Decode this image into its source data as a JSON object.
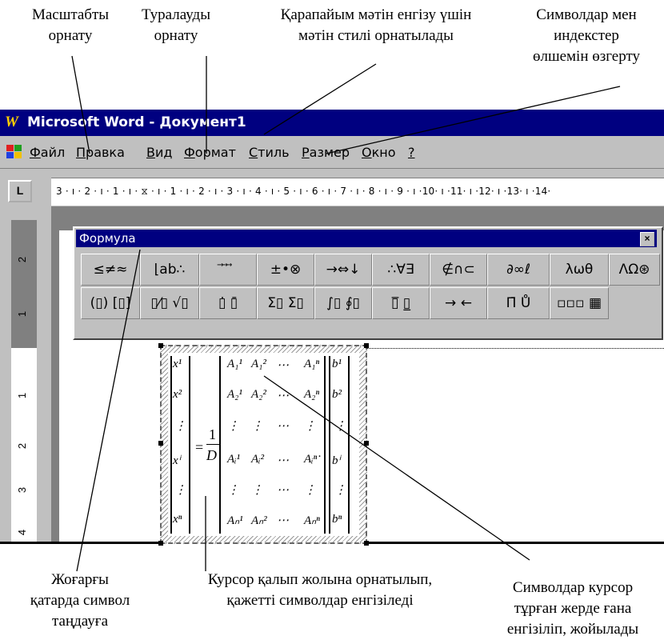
{
  "captions": {
    "top_scale": "Масштабты\nорнату",
    "top_align": "Туралауды\nорнату",
    "top_text": "Қарапайым мәтін енгізу үшін\nмәтін стилі орнатылады",
    "top_size": "Символдар мен\nиндекстер\nөлшемін өзгерту",
    "bottom_upper": "Жоғарғы\nқатарда символ\nтаңдауға",
    "bottom_cursor": "Курсор қалып жолына орнатылып,\nқажетті символдар енгізіледі",
    "bottom_symbols": "Символдар курсор\nтұрған жерде ғана\nенгізіліп, жойылады"
  },
  "window": {
    "icon": "W",
    "title": "Microsoft Word - Документ1"
  },
  "menu": {
    "items": [
      "Файл",
      "Правка",
      "Вид",
      "Формат",
      "Стиль",
      "Размер",
      "Окно",
      "?"
    ]
  },
  "ruler": {
    "tab_button": "L",
    "numbers": "3 · ı · 2 · ı · 1 · ı · ⧖ · ı · 1 · ı · 2 · ı · 3 · ı · 4 · ı · 5 · ı · 6 · ı · 7 · ı · 8 · ı · 9 · ı ·10· ı ·11· ı ·12· ı ·13· ı ·14·",
    "vertical": [
      "2",
      "1",
      "1",
      "2",
      "3",
      "4"
    ]
  },
  "palette": {
    "title": "Формула",
    "close": "×",
    "row1": [
      "≤≠≈",
      "⌊ab∴",
      "⃗ ⃗ ⃗",
      "±•⊗",
      "→⇔↓",
      "∴∀∃",
      "∉∩⊂",
      "∂∞ℓ",
      "λωθ",
      "ΛΩ⊛"
    ],
    "row2": [
      "(▯) [▯]",
      "▯⁄▯ √▯",
      "▯̇ ▯̄",
      "Σ▯ Σ▯",
      "∫▯ ∮▯",
      "▯̅ ▯̲",
      "→ ←",
      "Π̄ Ů",
      "▫▫▫ ▦"
    ]
  },
  "equation": {
    "x_col": [
      "x¹",
      "x²",
      "⋮",
      "xⁱ",
      "⋮",
      "xⁿ"
    ],
    "fraction_num": "1",
    "fraction_den": "D",
    "eq_sign": "=",
    "row_labels": [
      "A₁¹",
      "A₁²",
      "⋯",
      "A₁ⁿ"
    ],
    "rows": [
      [
        "A₁¹",
        "A₁²",
        "⋯",
        "A₁ⁿ"
      ],
      [
        "A₂¹",
        "A₂²",
        "⋯",
        "A₂ⁿ"
      ],
      [
        "⋮",
        "⋮",
        "⋯",
        "⋮"
      ],
      [
        "Aᵢ¹",
        "Aᵢ²",
        "⋯",
        "Aᵢⁿ"
      ],
      [
        "⋮",
        "⋮",
        "⋯",
        "⋮"
      ],
      [
        "Aₙ¹",
        "Aₙ²",
        "⋯",
        "Aₙⁿ"
      ]
    ],
    "b_col": [
      "b¹",
      "b²",
      "⋮",
      "bⁱ",
      "⋮",
      "bⁿ"
    ],
    "dot": "."
  }
}
